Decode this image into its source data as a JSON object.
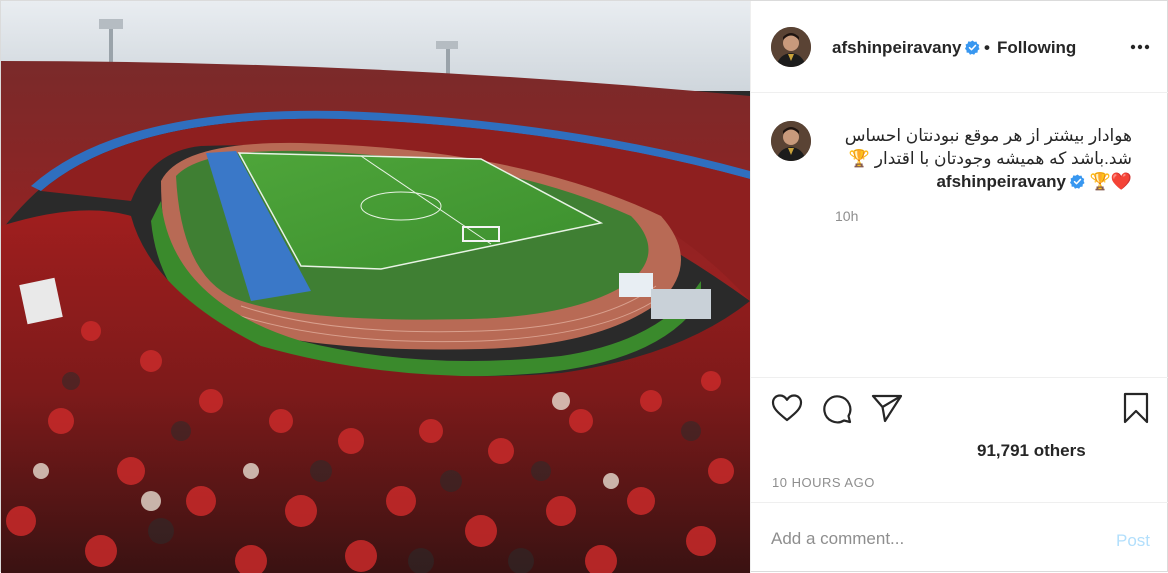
{
  "post": {
    "username": "afshinpeiravany",
    "follow_separator": "•",
    "follow_status": "Following",
    "caption": "هوادار بیشتر از هر موقع نبودنتان احساس شد.باشد که همیشه وجودتان با اقتدار 🏆❤️🏆",
    "caption_time": "10h",
    "likes_text": "91,791 others",
    "timestamp": "10 HOURS AGO",
    "comment_placeholder": "Add a comment...",
    "post_button": "Post"
  },
  "icons": {
    "verified": "verified-badge-icon",
    "more": "more-options-icon",
    "like": "heart-icon",
    "comment": "comment-icon",
    "share": "paper-plane-icon",
    "save": "bookmark-icon"
  },
  "colors": {
    "verified_blue": "#3897f0",
    "post_button_disabled": "#b2dffc",
    "muted_text": "#8e8e8e",
    "border": "#efefef"
  }
}
